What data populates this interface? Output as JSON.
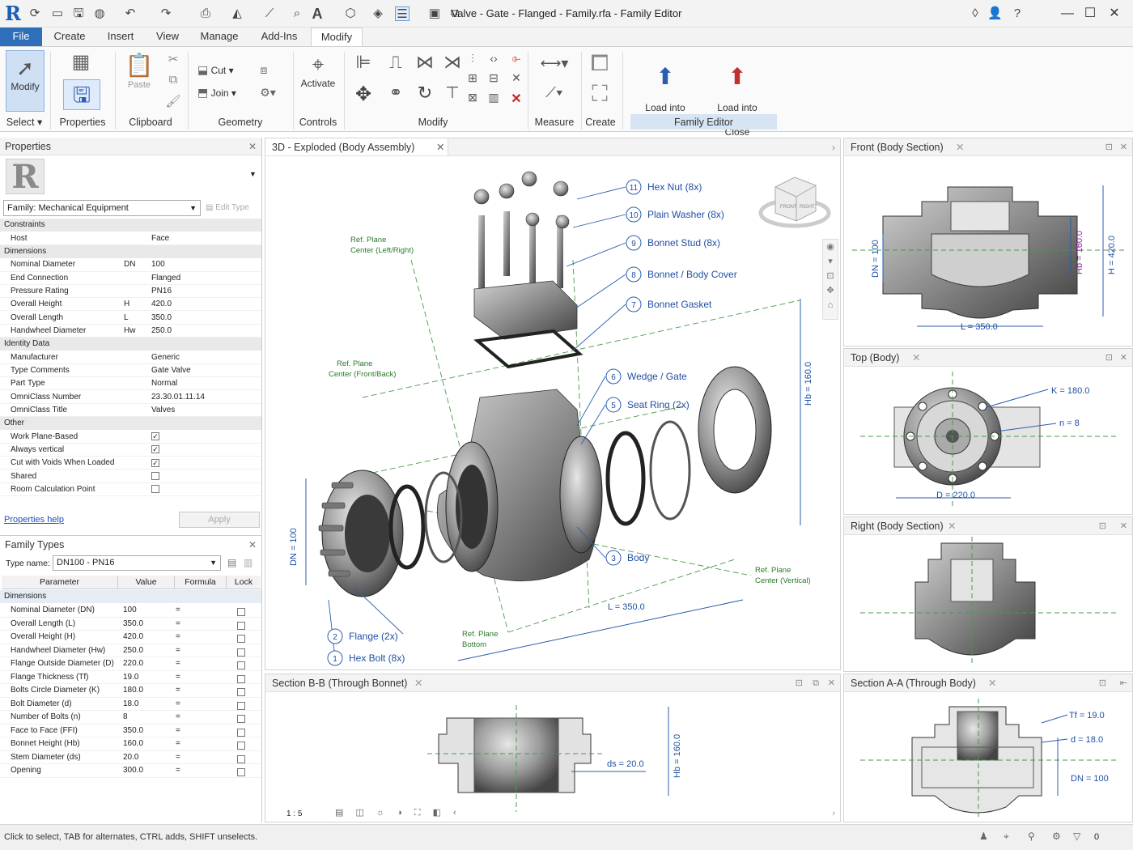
{
  "app": {
    "logo": "R",
    "title": "Valve - Gate - Flanged - Family.rfa - Family Editor"
  },
  "menu_tabs": [
    "File",
    "Create",
    "Insert",
    "View",
    "Manage",
    "Add-Ins",
    "Modify"
  ],
  "ribbon": {
    "modify": "Modify",
    "select": "Select",
    "properties": "Properties",
    "paste": "Paste",
    "clipboard": "Clipboard",
    "cut": "Cut",
    "join": "Join",
    "geometry": "Geometry",
    "activate": "Activate",
    "controls": "Controls",
    "modify_panel": "Modify",
    "measure": "Measure",
    "create": "Create",
    "load_into_project": "Load into\nProject",
    "load_into_project_close": "Load into\nProject and Close",
    "family_editor": "Family Editor"
  },
  "properties": {
    "header": "Properties",
    "family_selector": "Family: Mechanical Equipment",
    "edit_type": "Edit Type",
    "groups": [
      {
        "name": "Constraints",
        "rows": [
          {
            "name": "Host",
            "sym": "",
            "value": "Face"
          }
        ]
      },
      {
        "name": "Dimensions",
        "rows": [
          {
            "name": "Nominal Diameter",
            "sym": "DN",
            "value": "100"
          },
          {
            "name": "End Connection",
            "sym": "",
            "value": "Flanged"
          },
          {
            "name": "Pressure Rating",
            "sym": "",
            "value": "PN16"
          },
          {
            "name": "Overall Height",
            "sym": "H",
            "value": "420.0"
          },
          {
            "name": "Overall Length",
            "sym": "L",
            "value": "350.0"
          },
          {
            "name": "Handwheel Diameter",
            "sym": "Hw",
            "value": "250.0"
          }
        ]
      },
      {
        "name": "Identity Data",
        "rows": [
          {
            "name": "Manufacturer",
            "sym": "",
            "value": "Generic"
          },
          {
            "name": "Type Comments",
            "sym": "",
            "value": "Gate Valve"
          },
          {
            "name": "Part Type",
            "sym": "",
            "value": "Normal"
          },
          {
            "name": "OmniClass Number",
            "sym": "",
            "value": "23.30.01.11.14"
          },
          {
            "name": "OmniClass Title",
            "sym": "",
            "value": "Valves"
          }
        ]
      },
      {
        "name": "Other",
        "rows": [
          {
            "name": "Work Plane-Based",
            "sym": "",
            "value": "",
            "checked": true
          },
          {
            "name": "Always vertical",
            "sym": "",
            "value": "",
            "checked": true
          },
          {
            "name": "Cut with Voids When Loaded",
            "sym": "",
            "value": "",
            "checked": true
          },
          {
            "name": "Shared",
            "sym": "",
            "value": "",
            "checked": false
          },
          {
            "name": "Room Calculation Point",
            "sym": "",
            "value": "",
            "checked": false
          }
        ]
      }
    ],
    "help_link": "Properties help",
    "apply": "Apply"
  },
  "family_types": {
    "header": "Family Types",
    "type_name_label": "Type name:",
    "type_name_value": "DN100 - PN16",
    "columns": [
      "Parameter",
      "Value",
      "Formula",
      "Lock"
    ],
    "group": "Dimensions",
    "rows": [
      {
        "name": "Nominal Diameter (DN)",
        "value": "100",
        "formula": "="
      },
      {
        "name": "Overall Length (L)",
        "value": "350.0",
        "formula": "="
      },
      {
        "name": "Overall Height (H)",
        "value": "420.0",
        "formula": "="
      },
      {
        "name": "Handwheel Diameter (Hw)",
        "value": "250.0",
        "formula": "="
      },
      {
        "name": "Flange Outside Diameter (D)",
        "value": "220.0",
        "formula": "="
      },
      {
        "name": "Flange Thickness (Tf)",
        "value": "19.0",
        "formula": "="
      },
      {
        "name": "Bolts Circle Diameter (K)",
        "value": "180.0",
        "formula": "="
      },
      {
        "name": "Bolt Diameter (d)",
        "value": "18.0",
        "formula": "="
      },
      {
        "name": "Number of Bolts (n)",
        "value": "8",
        "formula": "="
      },
      {
        "name": "Face to Face (FFI)",
        "value": "350.0",
        "formula": "="
      },
      {
        "name": "Bonnet Height (Hb)",
        "value": "160.0",
        "formula": "="
      },
      {
        "name": "Stem Diameter (ds)",
        "value": "20.0",
        "formula": "="
      },
      {
        "name": "Opening",
        "value": "300.0",
        "formula": "="
      }
    ]
  },
  "main_view": {
    "tab": "3D - Exploded  (Body Assembly)",
    "callouts": [
      {
        "num": "11",
        "label": "Hex Nut (8x)"
      },
      {
        "num": "10",
        "label": "Plain Washer (8x)"
      },
      {
        "num": "9",
        "label": "Bonnet Stud (8x)"
      },
      {
        "num": "8",
        "label": "Bonnet / Body Cover"
      },
      {
        "num": "7",
        "label": "Bonnet Gasket"
      },
      {
        "num": "6",
        "label": "Wedge / Gate"
      },
      {
        "num": "5",
        "label": "Seat Ring (2x)"
      },
      {
        "num": "3",
        "label": "Body"
      },
      {
        "num": "2",
        "label": "Flange (2x)"
      },
      {
        "num": "1",
        "label": "Hex Bolt (8x)"
      }
    ],
    "ref_planes": {
      "left_right": [
        "Ref. Plane",
        "Center (Left/Right)"
      ],
      "front_back": [
        "Ref. Plane",
        "Center (Front/Back)"
      ],
      "vertical": [
        "Ref. Plane",
        "Center (Vertical)"
      ],
      "bottom": [
        "Ref. Plane",
        "Bottom"
      ]
    },
    "dims": {
      "dn": "DN = 100",
      "hb": "Hb = 160.0",
      "l": "L = 350.0"
    },
    "viewcube": {
      "front": "FRONT",
      "right": "RIGHT"
    }
  },
  "views": {
    "front": {
      "tab": "Front  (Body Section)",
      "dn": "DN = 100",
      "hb": "Hb = 160.0",
      "h": "H = 420.0",
      "l": "L = 350.0"
    },
    "top": {
      "tab": "Top  (Body)",
      "k": "K = 180.0",
      "n": "n = 8",
      "d": "D = 220.0"
    },
    "right": {
      "tab": "Right  (Body Section)"
    },
    "section_bb": {
      "tab": "Section B-B  (Through Bonnet)",
      "ds": "ds = 20.0",
      "hb": "Hb = 160.0",
      "scale": "1 : 5"
    },
    "section_aa": {
      "tab": "Section A-A  (Through Body)",
      "tf": "Tf = 19.0",
      "d": "d = 18.0",
      "dn": "DN = 100"
    }
  },
  "status": {
    "message": "Click to select, TAB for alternates, CTRL adds, SHIFT unselects.",
    "count": "0"
  }
}
